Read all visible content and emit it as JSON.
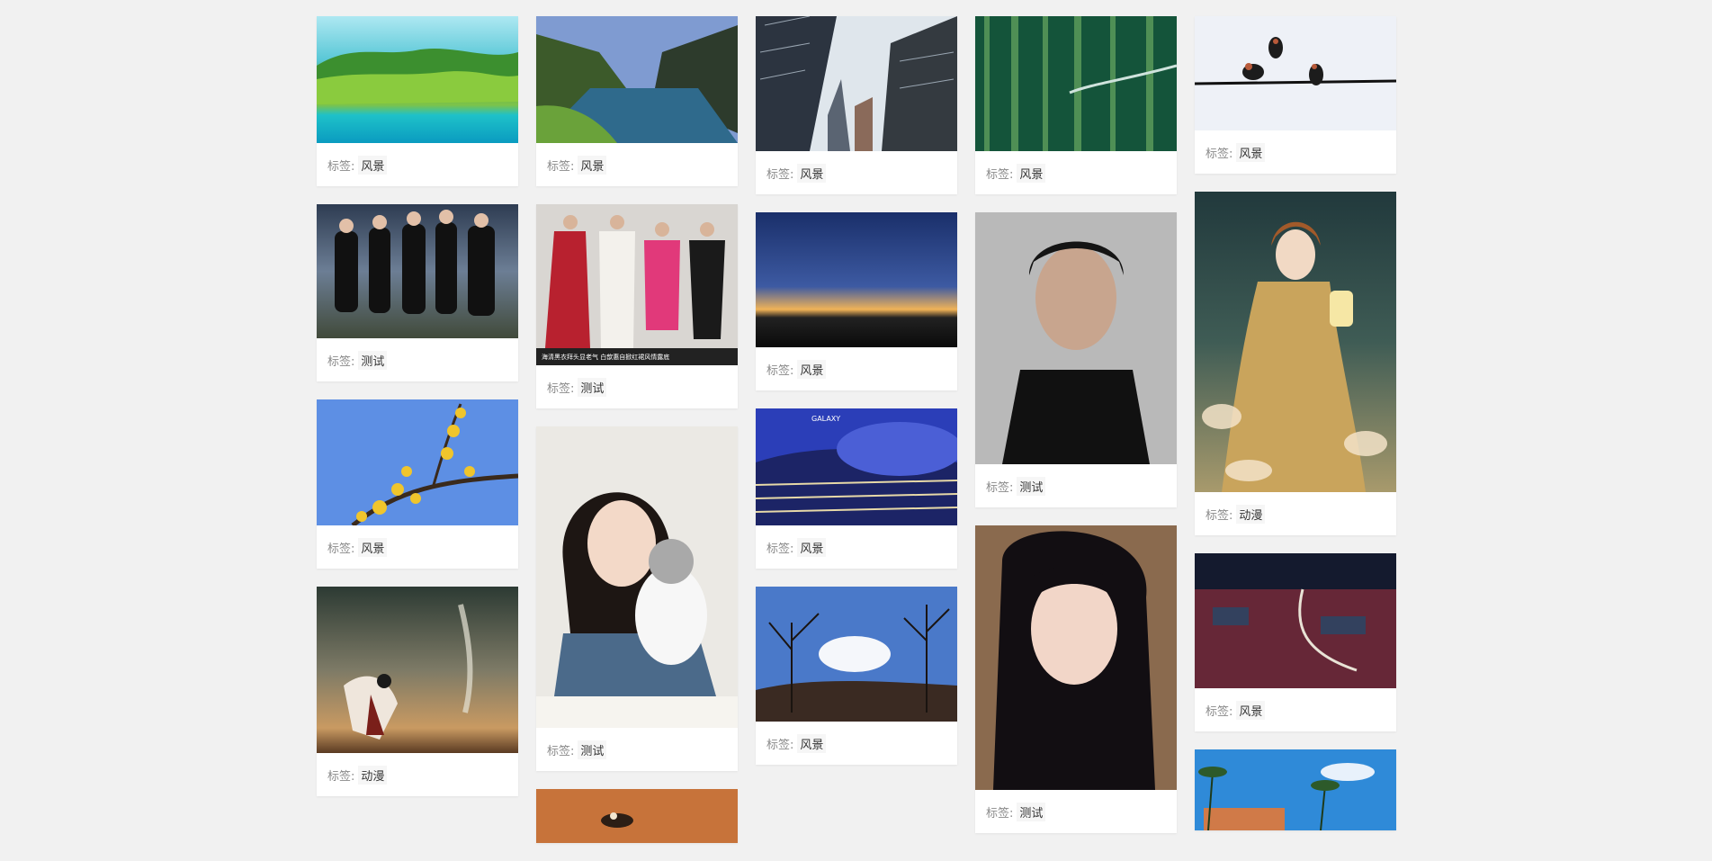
{
  "tag_prefix": "标签:",
  "columns": [
    [
      {
        "tag": "风景",
        "alt": "湖光山色"
      },
      {
        "tag": "测试",
        "alt": "乐队合影"
      },
      {
        "tag": "风景",
        "alt": "黄色梅花"
      },
      {
        "tag": "动漫",
        "alt": "动漫人物与龙卷风"
      }
    ],
    [
      {
        "tag": "风景",
        "alt": "峡湾风光"
      },
      {
        "tag": "测试",
        "alt": "红毯明星",
        "caption_text": "海清黑衣拜头显老气 白歆惠自掀红裙风情露底"
      },
      {
        "tag": "测试",
        "alt": "女孩与猫"
      },
      {
        "tag": "",
        "alt": "小鸟"
      }
    ],
    [
      {
        "tag": "风景",
        "alt": "仰视高楼"
      },
      {
        "tag": "风景",
        "alt": "日落云层"
      },
      {
        "tag": "风景",
        "alt": "现代建筑",
        "logo_text": "GALAXY"
      },
      {
        "tag": "风景",
        "alt": "枯树蓝天"
      }
    ],
    [
      {
        "tag": "风景",
        "alt": "绿色倒影"
      },
      {
        "tag": "测试",
        "alt": "男士黑白肖像"
      },
      {
        "tag": "测试",
        "alt": "长发女孩"
      }
    ],
    [
      {
        "tag": "风景",
        "alt": "电线上的燕子"
      },
      {
        "tag": "动漫",
        "alt": "古风少女提灯"
      },
      {
        "tag": "风景",
        "alt": "夜景城市"
      },
      {
        "tag": "",
        "alt": "海边度假"
      }
    ]
  ]
}
